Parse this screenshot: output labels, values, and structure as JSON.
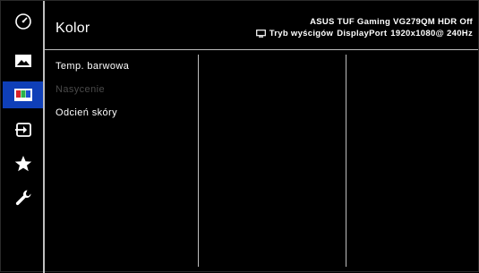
{
  "header": {
    "title": "Kolor",
    "model_info": "ASUS TUF Gaming  VG279QM HDR Off",
    "mode": "Tryb wyścigów",
    "input": "DisplayPort",
    "resolution": "1920x1080@ 240Hz"
  },
  "sidebar": {
    "items": [
      {
        "icon": "gauge-icon",
        "active": false
      },
      {
        "icon": "image-icon",
        "active": false
      },
      {
        "icon": "color-bars-icon",
        "active": true
      },
      {
        "icon": "input-icon",
        "active": false
      },
      {
        "icon": "star-icon",
        "active": false
      },
      {
        "icon": "wrench-icon",
        "active": false
      }
    ]
  },
  "menu": {
    "items": [
      {
        "label": "Temp. barwowa",
        "enabled": true
      },
      {
        "label": "Nasycenie",
        "enabled": false
      },
      {
        "label": "Odcień skóry",
        "enabled": true
      }
    ]
  },
  "colors": {
    "active_highlight": "#0f3fb8",
    "text": "#ffffff",
    "disabled_text": "#4a4a4a",
    "divider": "#bdbdbd"
  }
}
